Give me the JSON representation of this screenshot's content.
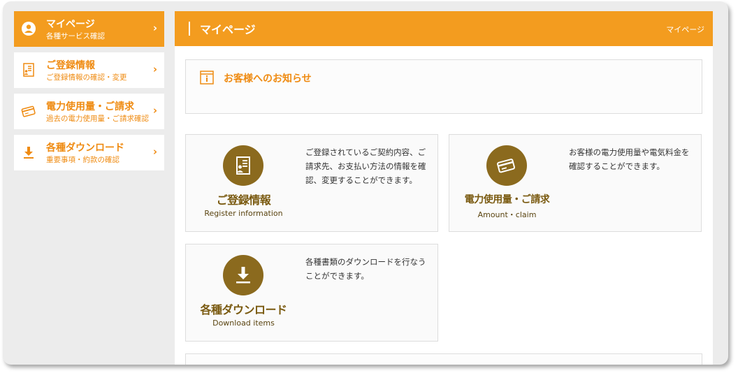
{
  "sidebar": {
    "items": [
      {
        "title": "マイページ",
        "sub": "各種サービス確認",
        "icon": "user-circle-icon",
        "active": true
      },
      {
        "title": "ご登録情報",
        "sub": "ご登録情報の確認・変更",
        "icon": "document-icon"
      },
      {
        "title": "電力使用量・ご請求",
        "sub": "過去の電力使用量・ご請求確認",
        "icon": "card-icon"
      },
      {
        "title": "各種ダウンロード",
        "sub": "重要事項・約款の確認",
        "icon": "download-icon"
      }
    ],
    "chevron": "›"
  },
  "header": {
    "title": "マイページ",
    "breadcrumb": "マイページ"
  },
  "notice": {
    "title": "お客様へのお知らせ",
    "icon": "info-icon"
  },
  "cards": [
    {
      "title": "ご登録情報",
      "sub": "Register information",
      "desc": "ご登録されているご契約内容、ご請求先、お支払い方法の情報を確認、変更することができます。",
      "icon": "document-icon"
    },
    {
      "title": "電力使用量・ご請求",
      "sub": "Amount・claim",
      "desc": "お客様の電力使用量や電気料金を確認することができます。",
      "icon": "card-icon"
    },
    {
      "title": "各種ダウンロード",
      "sub": "Download items",
      "desc": "各種書類のダウンロードを行なうことができます。",
      "icon": "download-icon"
    }
  ],
  "colors": {
    "accent": "#f39c1f",
    "accent_text": "#ef8b12",
    "card_icon_bg": "#8b6a1e",
    "card_title": "#7a5a10"
  }
}
